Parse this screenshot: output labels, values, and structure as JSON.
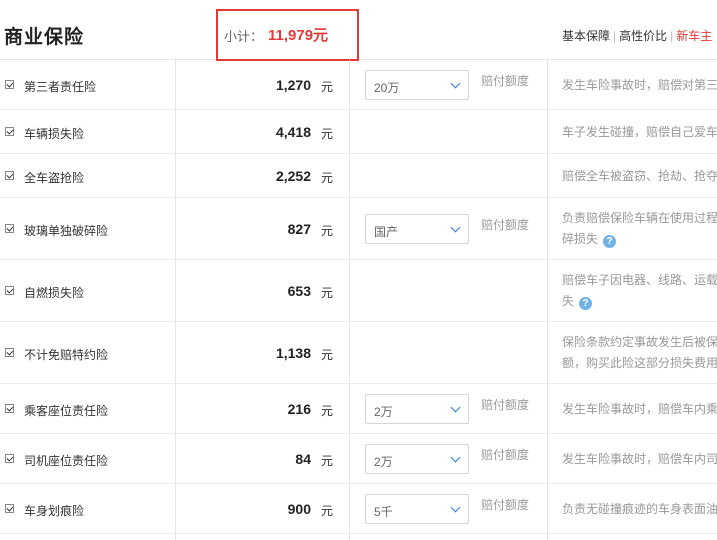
{
  "header": {
    "title": "商业保险",
    "subtotal_label": "小计：",
    "subtotal_value": "11,979元",
    "tabs": [
      "基本保障",
      "高性价比",
      "新车主"
    ],
    "active_tab_index": 2,
    "accent_color": "#e53935",
    "link_color": "#2a7ad5"
  },
  "coverage_label": "赔付额度",
  "rows": [
    {
      "name": "第三者责任险",
      "checked": true,
      "price": "1,270",
      "unit": "元",
      "select": "20万",
      "desc": [
        "发生车险事故时，赔偿对第三"
      ],
      "help": false
    },
    {
      "name": "车辆损失险",
      "checked": true,
      "price": "4,418",
      "unit": "元",
      "select": null,
      "desc": [
        "车子发生碰撞，赔偿自己爱车"
      ],
      "help": false
    },
    {
      "name": "全车盗抢险",
      "checked": true,
      "price": "2,252",
      "unit": "元",
      "select": null,
      "desc": [
        "赔偿全车被盗窃、抢劫、抢夺"
      ],
      "help": false
    },
    {
      "name": "玻璃单独破碎险",
      "checked": true,
      "price": "827",
      "unit": "元",
      "select": "国产",
      "desc": [
        "负责赔偿保险车辆在使用过程",
        "碎损失"
      ],
      "help": true
    },
    {
      "name": "自燃损失险",
      "checked": true,
      "price": "653",
      "unit": "元",
      "select": null,
      "desc": [
        "赔偿车子因电器、线路、运载",
        "失"
      ],
      "help": true
    },
    {
      "name": "不计免赔特约险",
      "checked": true,
      "price": "1,138",
      "unit": "元",
      "select": null,
      "desc": [
        "保险条款约定事故发生后被保",
        "额，购买此险这部分损失费用"
      ],
      "help": false
    },
    {
      "name": "乘客座位责任险",
      "checked": true,
      "price": "216",
      "unit": "元",
      "select": "2万",
      "desc": [
        "发生车险事故时，赔偿车内乘"
      ],
      "help": false
    },
    {
      "name": "司机座位责任险",
      "checked": true,
      "price": "84",
      "unit": "元",
      "select": "2万",
      "desc": [
        "发生车险事故时，赔偿车内司"
      ],
      "help": false
    },
    {
      "name": "车身划痕险",
      "checked": true,
      "price": "900",
      "unit": "元",
      "select": "5千",
      "desc": [
        "负责无碰撞痕迹的车身表面油"
      ],
      "help": false
    }
  ]
}
